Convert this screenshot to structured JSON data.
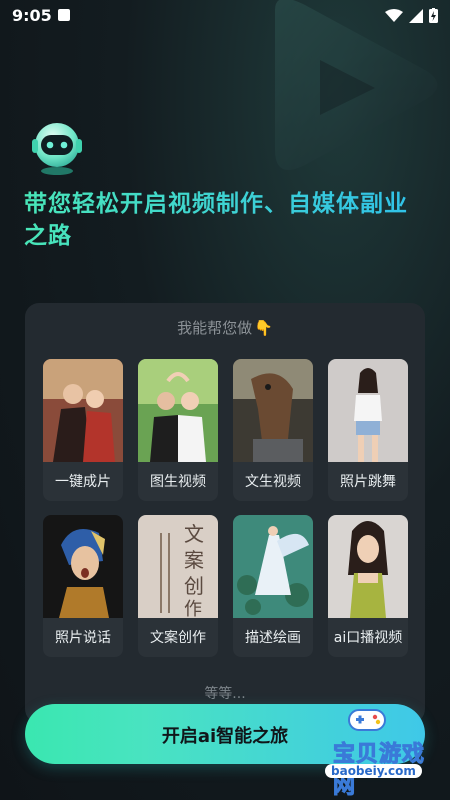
{
  "status": {
    "time": "9:05"
  },
  "headline": "带您轻松开启视频制作、自媒体副业之路",
  "panel": {
    "title": "我能帮您做",
    "more": "等等...",
    "items": [
      {
        "label": "一键成片"
      },
      {
        "label": "图生视频"
      },
      {
        "label": "文生视频"
      },
      {
        "label": "照片跳舞"
      },
      {
        "label": "照片说话"
      },
      {
        "label": "文案创作"
      },
      {
        "label": "描述绘画"
      },
      {
        "label": "ai口播视频"
      }
    ]
  },
  "cta": {
    "label": "开启ai智能之旅"
  },
  "watermark": {
    "title": "宝贝游戏网",
    "url": "baobeiy.com"
  },
  "colors": {
    "accent_start": "#3ae7b0",
    "accent_end": "#3fc8e8",
    "panel_bg": "#232a30"
  }
}
